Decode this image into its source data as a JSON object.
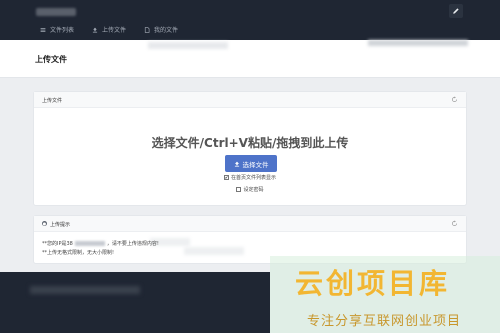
{
  "nav": {
    "items": [
      {
        "label": "文件列表",
        "icon": "list-icon"
      },
      {
        "label": "上传文件",
        "icon": "upload-icon"
      },
      {
        "label": "我的文件",
        "icon": "file-icon"
      }
    ],
    "edit_icon": "pencil-icon"
  },
  "page": {
    "title": "上传文件"
  },
  "upload_card": {
    "header": "上传文件",
    "drop_hint": "选择文件/Ctrl+V粘贴/拖拽到此上传",
    "button_label": "选择文件",
    "option_list_label": "在首页文件列表显示",
    "option_list_checked": true,
    "option_password_label": "设定密码",
    "option_password_checked": false
  },
  "tips_card": {
    "header": "上传提示",
    "line1_prefix": "**您的IP是38",
    "line1_suffix": "，请不要上传违规内容!",
    "line2": "**上传无格式限制，无大小限制!"
  },
  "watermark": {
    "main": "云创项目库",
    "sub": "专注分享互联网创业项目"
  },
  "colors": {
    "nav_bg": "#1f2633",
    "page_bg": "#eceef1",
    "primary_button": "#4e73c9",
    "watermark_main": "#f2b632"
  }
}
